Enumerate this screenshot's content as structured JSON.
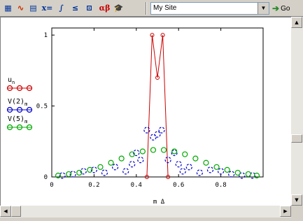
{
  "toolbar": {
    "buttons": [
      {
        "name": "calculator-icon",
        "glyph": "▦"
      },
      {
        "name": "graph-icon",
        "glyph": "∿"
      },
      {
        "name": "matrix-icon",
        "glyph": "▤"
      },
      {
        "name": "evaluation-icon",
        "glyph": "x="
      },
      {
        "name": "calculus-icon",
        "glyph": "∫"
      },
      {
        "name": "boolean-icon",
        "glyph": "≤"
      },
      {
        "name": "programming-icon",
        "glyph": "⊡"
      },
      {
        "name": "greek-icon",
        "glyph": "αβ"
      },
      {
        "name": "symbolic-icon",
        "glyph": "🎓"
      }
    ],
    "site_value": "My Site",
    "go_label": "Go"
  },
  "plot": {
    "xlabel": "m Δ",
    "legend": [
      {
        "label": "u",
        "sub": "n",
        "color": "#cc0000"
      },
      {
        "label": "V(2)",
        "sub": "m",
        "color": "#0000cc"
      },
      {
        "label": "V(5)",
        "sub": "m",
        "color": "#00aa00"
      }
    ],
    "y_ticks": [
      "0",
      "0.5",
      "1"
    ],
    "x_ticks": [
      "0",
      "0.2",
      "0.4",
      "0.6",
      "0.8"
    ]
  },
  "chart_data": {
    "type": "line",
    "xlabel": "m Δ",
    "xlim": [
      0,
      1
    ],
    "ylim": [
      0,
      1.05
    ],
    "series": [
      {
        "name": "u_n",
        "color": "#cc0000",
        "style": "line-with-diamonds",
        "x": [
          0.45,
          0.475,
          0.5,
          0.525,
          0.55
        ],
        "y": [
          0,
          1,
          0.7,
          1,
          0
        ]
      },
      {
        "name": "V(2)_m",
        "color": "#0000cc",
        "style": "circles",
        "x": [
          0.05,
          0.1,
          0.15,
          0.2,
          0.25,
          0.3,
          0.35,
          0.38,
          0.4,
          0.42,
          0.45,
          0.48,
          0.5,
          0.52,
          0.55,
          0.58,
          0.6,
          0.62,
          0.65,
          0.7,
          0.75,
          0.8,
          0.85,
          0.9,
          0.95
        ],
        "y": [
          0.01,
          0.02,
          0.04,
          0.05,
          0.03,
          0.07,
          0.04,
          0.09,
          0.17,
          0.12,
          0.33,
          0.28,
          0.3,
          0.33,
          0.12,
          0.17,
          0.09,
          0.04,
          0.07,
          0.03,
          0.05,
          0.04,
          0.02,
          0.01,
          0.01
        ]
      },
      {
        "name": "V(5)_m",
        "color": "#00aa00",
        "style": "circles",
        "x": [
          0.03,
          0.08,
          0.13,
          0.18,
          0.23,
          0.28,
          0.33,
          0.38,
          0.43,
          0.48,
          0.53,
          0.58,
          0.63,
          0.68,
          0.73,
          0.78,
          0.83,
          0.88,
          0.93,
          0.97
        ],
        "y": [
          0.01,
          0.02,
          0.03,
          0.05,
          0.07,
          0.1,
          0.13,
          0.16,
          0.18,
          0.19,
          0.19,
          0.18,
          0.16,
          0.13,
          0.1,
          0.07,
          0.05,
          0.03,
          0.02,
          0.01
        ]
      }
    ]
  }
}
